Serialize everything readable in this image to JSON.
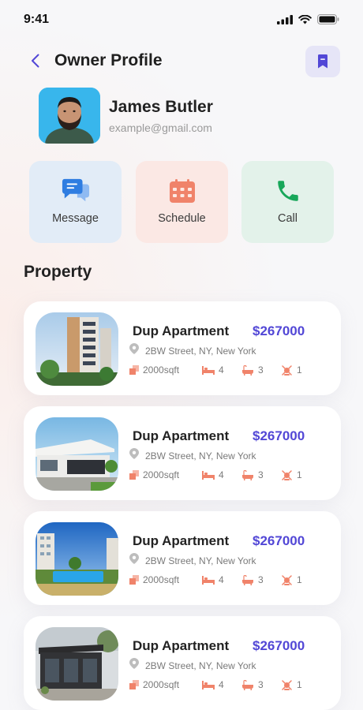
{
  "status": {
    "time": "9:41"
  },
  "header": {
    "title": "Owner Profile"
  },
  "owner": {
    "name": "James Butler",
    "email": "example@gmail.com"
  },
  "actions": [
    {
      "label": "Message",
      "icon": "chat-bubble-icon",
      "color": "#2f7de1",
      "bg": "#e2ecf7"
    },
    {
      "label": "Schedule",
      "icon": "calendar-icon",
      "color": "#f0836a",
      "bg": "#fbe8e4"
    },
    {
      "label": "Call",
      "icon": "phone-icon",
      "color": "#18a75a",
      "bg": "#e3f2ea"
    }
  ],
  "section": {
    "title": "Property"
  },
  "properties": [
    {
      "name": "Dup Apartment",
      "price": "$267000",
      "address": "2BW Street, NY, New York",
      "area": "2000sqft",
      "beds": "4",
      "baths": "3",
      "parking": "1"
    },
    {
      "name": "Dup Apartment",
      "price": "$267000",
      "address": "2BW Street, NY, New York",
      "area": "2000sqft",
      "beds": "4",
      "baths": "3",
      "parking": "1"
    },
    {
      "name": "Dup Apartment",
      "price": "$267000",
      "address": "2BW Street, NY, New York",
      "area": "2000sqft",
      "beds": "4",
      "baths": "3",
      "parking": "1"
    },
    {
      "name": "Dup Apartment",
      "price": "$267000",
      "address": "2BW Street, NY, New York",
      "area": "2000sqft",
      "beds": "4",
      "baths": "3",
      "parking": "1"
    }
  ],
  "colors": {
    "accent": "#5247d6",
    "feature_icon": "#f0836a"
  }
}
